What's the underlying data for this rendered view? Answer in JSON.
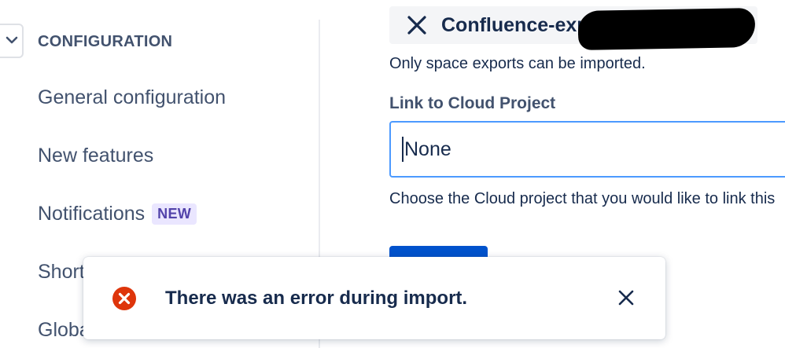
{
  "sidebar": {
    "section_heading": "CONFIGURATION",
    "collapse_icon": "chevron-down-icon",
    "items": [
      {
        "label": "General configuration"
      },
      {
        "label": "New features"
      },
      {
        "label": "Notifications",
        "badge": "NEW"
      },
      {
        "label": "Short"
      },
      {
        "label": "Globa"
      }
    ]
  },
  "main": {
    "file_chip": {
      "remove_icon": "close-icon",
      "name": "Confluence-exp"
    },
    "file_helper": "Only space exports can be imported.",
    "link_field": {
      "label": "Link to Cloud Project",
      "value": "None",
      "helper": "Choose the Cloud project that you would like to link this"
    }
  },
  "flag": {
    "icon": "error-icon",
    "message": "There was an error during import.",
    "dismiss_icon": "close-icon"
  },
  "colors": {
    "primary": "#0052CC",
    "focus": "#4C9AFF",
    "error": "#DE350B",
    "badge_bg": "#EAE6FF",
    "badge_text": "#5243AA",
    "text": "#172B4D",
    "subtle_text": "#42526E"
  }
}
